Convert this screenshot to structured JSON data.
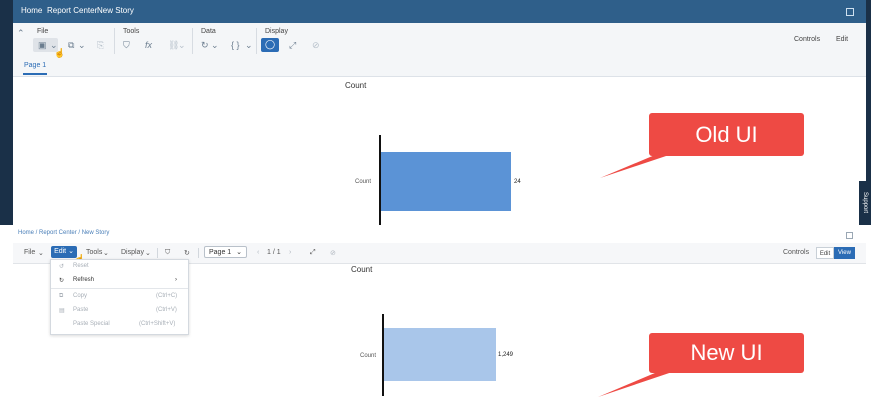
{
  "old_ui": {
    "breadcrumbs": [
      "Home",
      "Report Center",
      "New Story"
    ],
    "groups": {
      "file": "File",
      "tools": "Tools",
      "data": "Data",
      "display": "Display"
    },
    "right_actions": {
      "controls": "Controls",
      "edit": "Edit"
    },
    "page_tab": "Page 1",
    "chart": {
      "title": "Count",
      "category": "Count",
      "value_label": "24"
    },
    "callout": "Old UI"
  },
  "new_ui": {
    "breadcrumbs": "Home / Report Center / New Story",
    "menu_bar": {
      "file": "File",
      "edit": "Edit",
      "tools": "Tools",
      "display": "Display"
    },
    "page_select": "Page 1",
    "page_counter": "1 / 1",
    "right_actions": {
      "controls": "Controls",
      "edit": "Edit",
      "view": "View"
    },
    "edit_menu": [
      {
        "label": "Reset",
        "shortcut": ""
      },
      {
        "label": "Refresh",
        "shortcut": ""
      },
      {
        "label": "Copy",
        "shortcut": "(Ctrl+C)"
      },
      {
        "label": "Paste",
        "shortcut": "(Ctrl+V)"
      },
      {
        "label": "Paste Special",
        "shortcut": "(Ctrl+Shift+V)"
      }
    ],
    "chart": {
      "title": "Count",
      "category": "Count",
      "value_label": "1,249"
    },
    "callout": "New UI"
  },
  "support_tab": "Support",
  "colors": {
    "old_bar": "#5b93d6",
    "new_bar": "#a9c6ea",
    "callout": "#ee4a44",
    "topbar": "#2f5f8a",
    "accent": "#2b6cb5"
  }
}
